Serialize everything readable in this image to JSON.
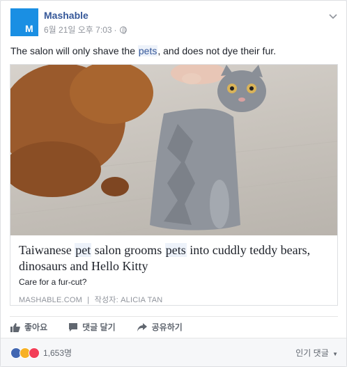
{
  "post": {
    "page_name": "Mashable",
    "avatar_letter": "M",
    "timestamp": "6월 21일 오후 7:03",
    "separator": "·",
    "message_parts": [
      "The salon will only shave the ",
      "pets",
      ", and does not dye their fur."
    ]
  },
  "link": {
    "headline_parts": [
      "Taiwanese ",
      "pet",
      " salon grooms ",
      "pets",
      " into cuddly teddy bears, dinosaurs and Hello Kitty"
    ],
    "description": "Care for a fur-cut?",
    "source": "MASHABLE.COM",
    "divider": "|",
    "author": "작성자: ALICIA TAN"
  },
  "actions": {
    "like": "좋아요",
    "comment": "댓글 달기",
    "share": "공유하기"
  },
  "footer": {
    "reaction_count": "1,653명",
    "sort_label": "인기 댓글",
    "colors": {
      "like": "#4267b2",
      "haha": "#f7b125",
      "love": "#f33e58"
    }
  }
}
